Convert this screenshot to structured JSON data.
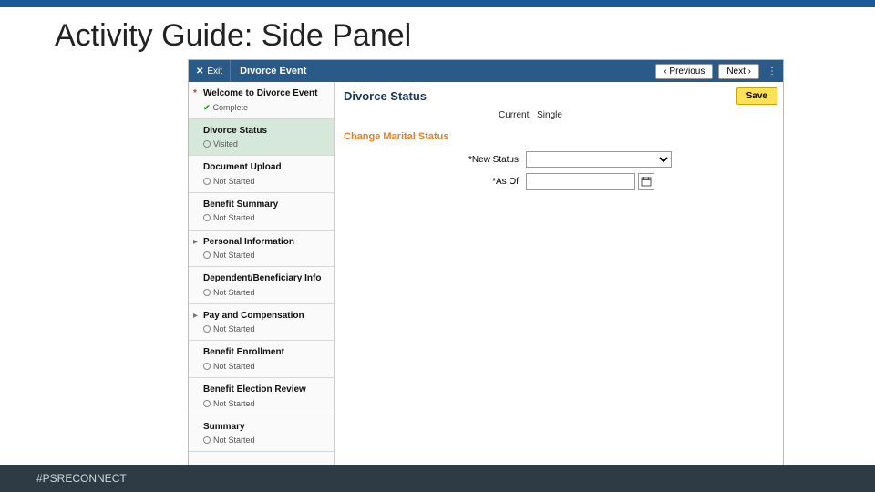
{
  "slide": {
    "title": "Activity Guide: Side Panel"
  },
  "header": {
    "exit_label": "Exit",
    "breadcrumb": "Divorce Event",
    "prev_label": "‹ Previous",
    "next_label": "Next ›",
    "more_label": "⋮"
  },
  "side": {
    "steps": [
      {
        "title": "Welcome to Divorce Event",
        "status": "Complete",
        "required": true,
        "expandable": false,
        "complete": true
      },
      {
        "title": "Divorce Status",
        "status": "Visited",
        "required": false,
        "expandable": false,
        "complete": false,
        "active": true
      },
      {
        "title": "Document Upload",
        "status": "Not Started",
        "required": false,
        "expandable": false,
        "complete": false
      },
      {
        "title": "Benefit Summary",
        "status": "Not Started",
        "required": false,
        "expandable": false,
        "complete": false
      },
      {
        "title": "Personal Information",
        "status": "Not Started",
        "required": false,
        "expandable": true,
        "complete": false
      },
      {
        "title": "Dependent/Beneficiary Info",
        "status": "Not Started",
        "required": false,
        "expandable": false,
        "complete": false
      },
      {
        "title": "Pay and Compensation",
        "status": "Not Started",
        "required": false,
        "expandable": true,
        "complete": false
      },
      {
        "title": "Benefit Enrollment",
        "status": "Not Started",
        "required": false,
        "expandable": false,
        "complete": false
      },
      {
        "title": "Benefit Election Review",
        "status": "Not Started",
        "required": false,
        "expandable": false,
        "complete": false
      },
      {
        "title": "Summary",
        "status": "Not Started",
        "required": false,
        "expandable": false,
        "complete": false
      }
    ]
  },
  "main": {
    "page_title": "Divorce Status",
    "save_label": "Save",
    "current_label": "Current",
    "current_value": "Single",
    "section_heading": "Change Marital Status",
    "new_status_label": "*New Status",
    "asof_label": "*As Of",
    "asof_value": ""
  },
  "footer": {
    "hashtag": "#PSRECONNECT"
  }
}
